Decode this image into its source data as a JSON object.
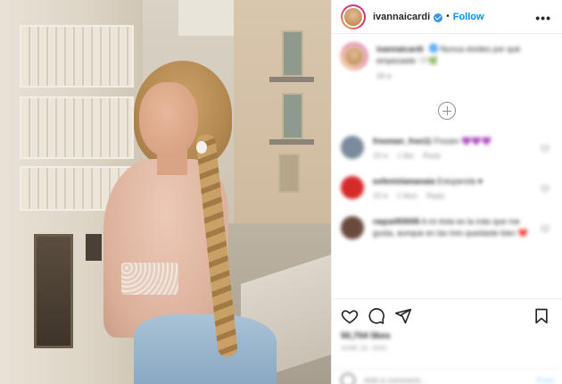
{
  "header": {
    "username": "ivannaicardi",
    "separator": "•",
    "follow_label": "Follow",
    "more_label": "•••"
  },
  "caption": {
    "username": "ivannaicardi",
    "text": "Nunca olvides por qué empezaste 🤍🌿",
    "time": "38 w"
  },
  "comments": [
    {
      "username": "freeman_free11",
      "text": "Frozen 💜💜💜",
      "time": "33 w",
      "likes": "1 like",
      "reply": "Reply",
      "avatar_color": "#7b8a9c"
    },
    {
      "username": "exfenixlamanaia",
      "text": "Estupenda ♥",
      "time": "33 w",
      "likes": "2 likes",
      "reply": "Reply",
      "avatar_color": "#d62a2a"
    },
    {
      "username": "raquel93008",
      "text": "A mi ésta es la más que me gusta, aunque en las tres quedaste bien ❤️",
      "time": "",
      "likes": "",
      "reply": "",
      "avatar_color": "#6b4a3e"
    }
  ],
  "actions": {
    "like_icon": "heart-icon",
    "comment_icon": "comment-icon",
    "share_icon": "share-icon",
    "save_icon": "bookmark-icon",
    "likes_count": "50,704 likes",
    "date": "JUNE 16, 2020"
  },
  "add_comment": {
    "placeholder": "Add a comment...",
    "post_label": "Post"
  },
  "colors": {
    "accent": "#0095f6",
    "verified": "#3897f0",
    "muted": "#8e8e8e"
  }
}
